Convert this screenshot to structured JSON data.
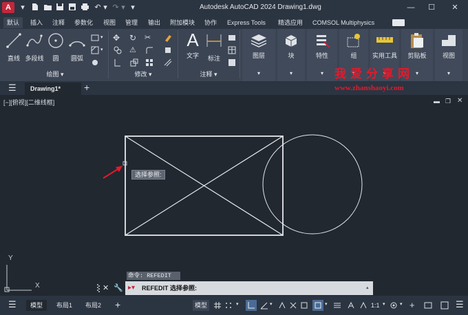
{
  "app": {
    "logo": "A",
    "title": "Autodesk AutoCAD 2024    Drawing1.dwg"
  },
  "ribbon_tabs": [
    "默认",
    "插入",
    "注释",
    "参数化",
    "视图",
    "管理",
    "输出",
    "附加模块",
    "协作",
    "Express Tools",
    "精选应用",
    "COMSOL Multiphysics"
  ],
  "ribbon": {
    "draw": {
      "line": "直线",
      "polyline": "多段线",
      "circle": "圆",
      "arc": "圆弧",
      "panel_label": "绘图 ▾"
    },
    "modify": {
      "panel_label": "修改 ▾"
    },
    "annotation": {
      "text": "文字",
      "dimension": "标注",
      "panel_label": "注释 ▾"
    },
    "layers": "图层",
    "block": "块",
    "properties": "特性",
    "groups": "组",
    "utilities": "实用工具",
    "clipboard": "剪贴板",
    "view": "视图"
  },
  "file_tabs": {
    "active": "Drawing1*"
  },
  "canvas": {
    "view_label": "[−][俯视][二维线框]",
    "tooltip": "选择参照:",
    "ucs": {
      "x": "X",
      "y": "Y"
    }
  },
  "command": {
    "history": "命令: REFEDIT",
    "current": "REFEDIT 选择参照:"
  },
  "status": {
    "model_tab": "模型",
    "layout1": "布局1",
    "layout2": "布局2",
    "model_btn": "模型",
    "scale": "1:1"
  },
  "watermark": {
    "title": "我爱分享网",
    "url": "www.zhanshaoyi.com"
  },
  "colors": {
    "accent_red": "#e6192b",
    "logo_red": "#c4263a",
    "canvas_bg": "#212830",
    "ribbon_bg": "#3b4453"
  }
}
